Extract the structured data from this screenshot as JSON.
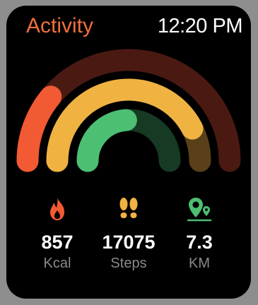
{
  "header": {
    "title": "Activity",
    "time": "12:20 PM"
  },
  "rings": [
    {
      "metric": "calories",
      "progress": 0.22,
      "color": "#f15a32",
      "track_color": "#4a1a12"
    },
    {
      "metric": "steps",
      "progress": 0.85,
      "color": "#f0b342",
      "track_color": "#5a4018"
    },
    {
      "metric": "distance",
      "progress": 0.48,
      "color": "#4cbf72",
      "track_color": "#163a24"
    }
  ],
  "stats": [
    {
      "icon": "flame-icon",
      "value": "857",
      "label": "Kcal",
      "color": "#f15a32"
    },
    {
      "icon": "footprints-icon",
      "value": "17075",
      "label": "Steps",
      "color": "#f0b342"
    },
    {
      "icon": "map-pin-icon",
      "value": "7.3",
      "label": "KM",
      "color": "#4cbf72"
    }
  ]
}
